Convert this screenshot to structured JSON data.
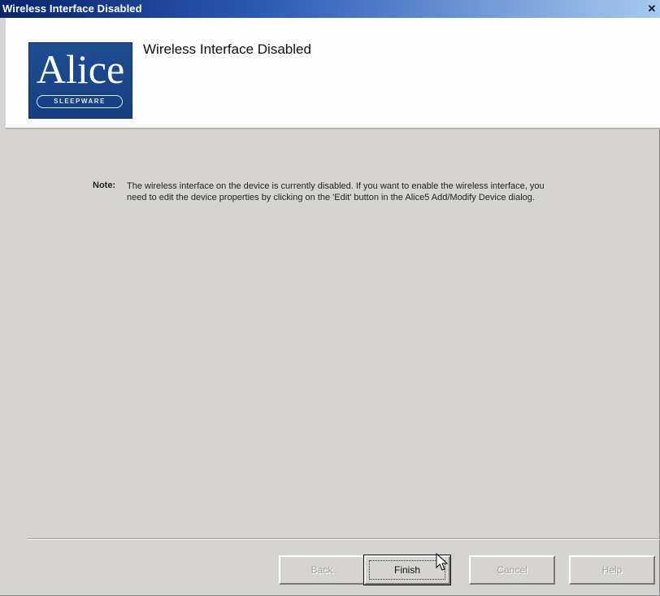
{
  "window": {
    "title": "Wireless Interface Disabled",
    "close_glyph": "✕"
  },
  "header": {
    "title": "Wireless Interface Disabled",
    "logo": {
      "word": "Alice",
      "badge": "SLEEPWARE"
    }
  },
  "note": {
    "label": "Note:",
    "text": "The wireless interface on the device is currently disabled. If you  want to enable the wireless interface, you need to edit the device properties by clicking on the 'Edit' button in the Alice5 Add/Modify Device dialog."
  },
  "buttons": {
    "back": "Back",
    "finish": "Finish",
    "cancel": "Cancel",
    "help": "Help"
  },
  "colors": {
    "titlebar_start": "#0a246a",
    "titlebar_end": "#a6caf0",
    "logo_bg": "#1f4d93",
    "dialog_bg": "#d6d4d0"
  },
  "icons": {
    "close": "close-icon",
    "cursor": "mouse-pointer-icon"
  }
}
